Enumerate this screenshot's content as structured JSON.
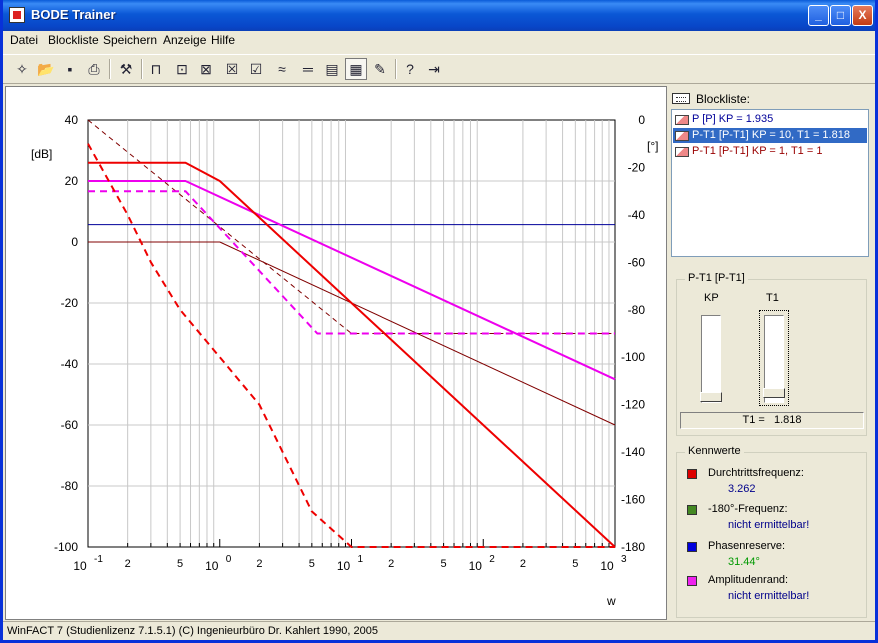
{
  "window": {
    "title": "BODE Trainer",
    "min_label": "_",
    "max_label": "□",
    "close_label": "X"
  },
  "menu": [
    {
      "label": "Datei"
    },
    {
      "label": "Blockliste"
    },
    {
      "label": "Speichern"
    },
    {
      "label": "Anzeige"
    },
    {
      "label": "Hilfe"
    }
  ],
  "toolbar": {
    "icons": [
      "new-file-icon",
      "open-folder-icon",
      "save-disk-icon",
      "print-icon",
      "bode-edit-icon",
      "p-block-icon",
      "pt1-block-icon",
      "dt1-block-icon",
      "delete-block-icon",
      "edit-block-icon",
      "waves-icon",
      "hline-icon",
      "grid-lines-icon",
      "table-icon",
      "pen-chart-icon",
      "help-icon",
      "exit-door-icon"
    ]
  },
  "blockliste": {
    "label": "Blockliste:",
    "items": [
      {
        "text": "P [P] KP = 1.935",
        "color": "#000099",
        "selected": false
      },
      {
        "text": "P-T1 [P-T1] KP = 10, T1 = 1.818",
        "color": "#ffffff",
        "selected": true
      },
      {
        "text": "P-T1 [P-T1] KP = 1, T1 = 1",
        "color": "#990000",
        "selected": false
      }
    ]
  },
  "params": {
    "group_title": "P-T1 [P-T1]",
    "kp_label": "KP",
    "t1_label": "T1",
    "kp_level": 0.0,
    "t1_level": 0.0,
    "readout_label": "T1 =",
    "readout_value": "1.818"
  },
  "kennwerte": {
    "title": "Kennwerte",
    "rows": [
      {
        "label": "Durchtrittsfrequenz:",
        "value": "3.262",
        "color": "#dd0000"
      },
      {
        "label": "-180°-Frequenz:",
        "value": "nicht ermittelbar!",
        "color": "#448822"
      },
      {
        "label": "Phasenreserve:",
        "value": "31.44°",
        "color": "#0000dd"
      },
      {
        "label": "Amplitudenrand:",
        "value": "nicht ermittelbar!",
        "color": "#ee22ee"
      }
    ]
  },
  "status": {
    "text": "WinFACT 7 (Studienlizenz 7.1.5.1)  (C) Ingenieurbüro Dr. Kahlert 1990, 2005"
  },
  "chart_data": {
    "type": "line",
    "xscale": "log",
    "xlim": [
      0.1,
      1000
    ],
    "ylim_left": [
      -100,
      40
    ],
    "ylim_right": [
      -180,
      0
    ],
    "ylabel_left": "[dB]",
    "ylabel_right": "[°]",
    "xlabel": "w",
    "y_ticks_left": [
      40,
      20,
      0,
      -20,
      -40,
      -60,
      -80,
      -100
    ],
    "y_ticks_right": [
      0,
      -20,
      -40,
      -60,
      -80,
      -100,
      -120,
      -140,
      -160,
      -180
    ],
    "x_decades": [
      {
        "base": "10",
        "exp": "-1"
      },
      {
        "base": "10",
        "exp": "0"
      },
      {
        "base": "10",
        "exp": "1"
      },
      {
        "base": "10",
        "exp": "2"
      },
      {
        "base": "10",
        "exp": "3"
      }
    ],
    "x_minor_labels": [
      "2",
      "5"
    ],
    "grid": true,
    "series": [
      {
        "role": "P magnitude",
        "color": "#000099",
        "dash": false,
        "width": 1,
        "axis": "left",
        "points": [
          [
            0.1,
            5.7
          ],
          [
            1000,
            5.7
          ]
        ]
      },
      {
        "role": "P-T1 KP=1 T1=1 magnitude",
        "color": "#800000",
        "dash": false,
        "width": 1,
        "axis": "left",
        "points": [
          [
            0.1,
            0
          ],
          [
            1,
            0
          ],
          [
            1000,
            -60
          ]
        ]
      },
      {
        "role": "P-T1 KP=1 T1=1 phase",
        "color": "#800000",
        "dash": true,
        "width": 1,
        "axis": "right",
        "points": [
          [
            0.1,
            0
          ],
          [
            10,
            -90
          ],
          [
            1000,
            -90
          ]
        ]
      },
      {
        "role": "sum magnitude",
        "color": "#ee00ee",
        "dash": false,
        "width": 2,
        "axis": "left",
        "points": [
          [
            0.1,
            20
          ],
          [
            0.55,
            20
          ],
          [
            1000,
            -45
          ]
        ]
      },
      {
        "role": "sum phase",
        "color": "#ee00ee",
        "dash": true,
        "width": 2,
        "axis": "right",
        "points": [
          [
            0.1,
            -30
          ],
          [
            0.55,
            -30
          ],
          [
            5.5,
            -90
          ],
          [
            1000,
            -90
          ]
        ]
      },
      {
        "role": "P-T1 KP=10 T1=1.818 magnitude",
        "color": "#ee0000",
        "dash": false,
        "width": 2,
        "axis": "left",
        "points": [
          [
            0.1,
            26
          ],
          [
            0.55,
            26
          ],
          [
            1,
            20
          ],
          [
            1000,
            -100
          ]
        ]
      },
      {
        "role": "P-T1 KP=10 T1=1.818 phase",
        "color": "#ee0000",
        "dash": true,
        "width": 2,
        "axis": "right",
        "points": [
          [
            0.1,
            -10
          ],
          [
            0.2,
            -40
          ],
          [
            0.3,
            -60
          ],
          [
            0.5,
            -80
          ],
          [
            1,
            -100
          ],
          [
            2,
            -120
          ],
          [
            5,
            -165
          ],
          [
            10,
            -180
          ],
          [
            1000,
            -180
          ]
        ]
      }
    ]
  }
}
